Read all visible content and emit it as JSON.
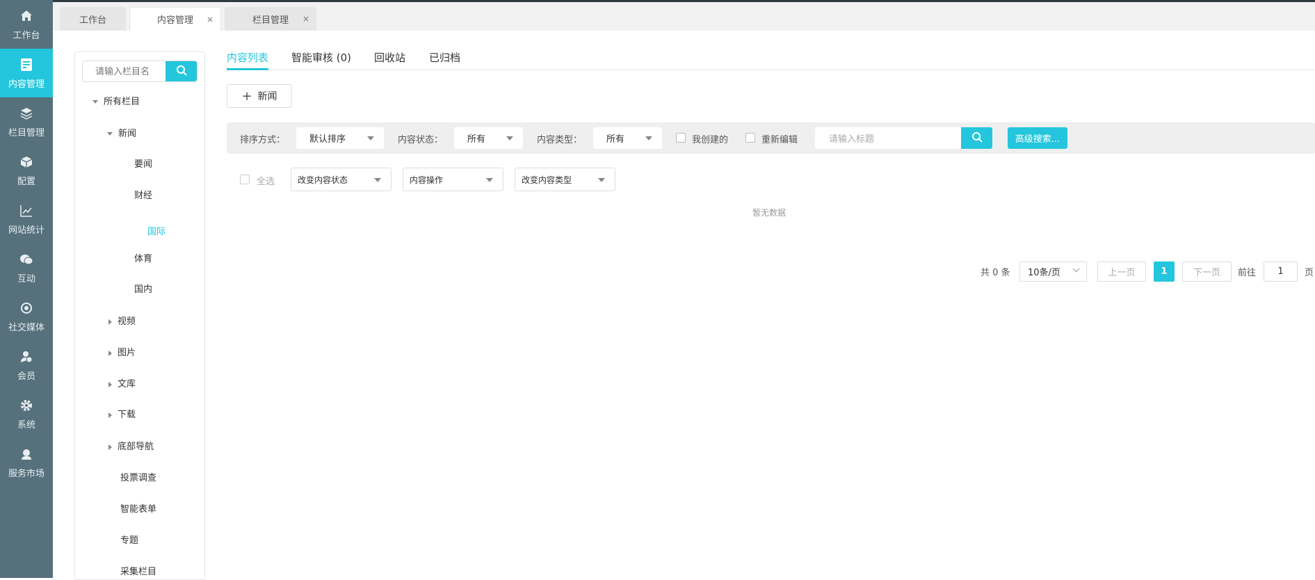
{
  "sidebar": {
    "items": [
      {
        "label": "工作台",
        "icon": "home-icon"
      },
      {
        "label": "内容管理",
        "icon": "document-edit-icon"
      },
      {
        "label": "栏目管理",
        "icon": "layers-icon"
      },
      {
        "label": "配置",
        "icon": "cube-icon"
      },
      {
        "label": "网站统计",
        "icon": "line-chart-icon"
      },
      {
        "label": "互动",
        "icon": "chat-icon"
      },
      {
        "label": "社交媒体",
        "icon": "social-icon"
      },
      {
        "label": "会员",
        "icon": "member-icon"
      },
      {
        "label": "系统",
        "icon": "gear-icon"
      },
      {
        "label": "服务市场",
        "icon": "service-icon"
      }
    ],
    "active": 1
  },
  "tabs": [
    {
      "label": "工作台"
    },
    {
      "label": "内容管理",
      "close": "×"
    },
    {
      "label": "栏目管理",
      "close": "×"
    }
  ],
  "tree": {
    "search_placeholder": "请输入栏目名",
    "items": [
      {
        "label": "所有栏目"
      },
      {
        "label": "新闻"
      },
      {
        "label": "要闻"
      },
      {
        "label": "财经"
      },
      {
        "label": "国际"
      },
      {
        "label": "体育"
      },
      {
        "label": "国内"
      },
      {
        "label": "视频"
      },
      {
        "label": "图片"
      },
      {
        "label": "文库"
      },
      {
        "label": "下载"
      },
      {
        "label": "底部导航"
      },
      {
        "label": "投票调查"
      },
      {
        "label": "智能表单"
      },
      {
        "label": "专题"
      },
      {
        "label": "采集栏目"
      }
    ]
  },
  "content_tabs": [
    {
      "label": "内容列表"
    },
    {
      "label": "智能审核 (0)"
    },
    {
      "label": "回收站"
    },
    {
      "label": "已归档"
    }
  ],
  "add_button": {
    "icon": "+",
    "label": "新闻"
  },
  "filter": {
    "sort_label": "排序方式：",
    "sort_value": "默认排序",
    "status_label": "内容状态：",
    "status_value": "所有",
    "type_label": "内容类型：",
    "type_value": "所有",
    "mine_label": "我创建的",
    "reedit_label": "重新编辑",
    "title_placeholder": "请输入标题",
    "advanced": "高级搜索..."
  },
  "batch": {
    "select_all": "全选",
    "change_status": "改变内容状态",
    "operation": "内容操作",
    "change_type": "改变内容类型"
  },
  "empty_text": "暂无数据",
  "pagination": {
    "total": "共 0 条",
    "page_size": "10条/页",
    "prev": "上一页",
    "current": "1",
    "next": "下一页",
    "goto_label": "前往",
    "goto_value": "1",
    "page_suffix": "页"
  },
  "colors": {
    "accent": "#23c6dc",
    "sidebar": "#56707c"
  }
}
